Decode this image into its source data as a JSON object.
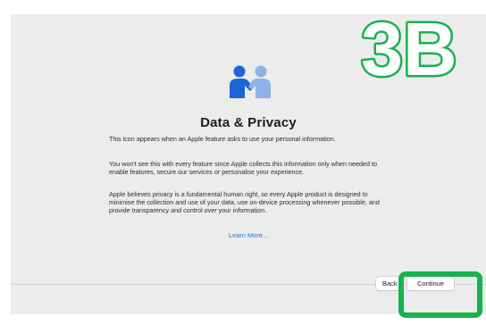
{
  "window": {
    "title": "Data & Privacy",
    "paragraphs": [
      "This icon appears when an Apple feature asks to use your personal information.",
      "You won't see this with every feature since Apple collects this information only when needed to enable features, secure our services or personalise your experience.",
      "Apple believes privacy is a fundamental human right, so every Apple product is designed to minimise the collection and use of your data, use on-device processing whenever possible, and provide transparency and control over your information."
    ],
    "learn_more": "Learn More..."
  },
  "footer": {
    "back_label": "Back",
    "continue_label": "Continue"
  },
  "overlay": {
    "step_label": "3B",
    "highlight_color": "#17b24e"
  },
  "icons": {
    "privacy_icon": "people-handshake-icon"
  },
  "colors": {
    "background": "#ececec",
    "link": "#2c6fd9",
    "icon_dark_blue": "#1f63d8",
    "icon_light_blue": "#8fb2e6"
  }
}
